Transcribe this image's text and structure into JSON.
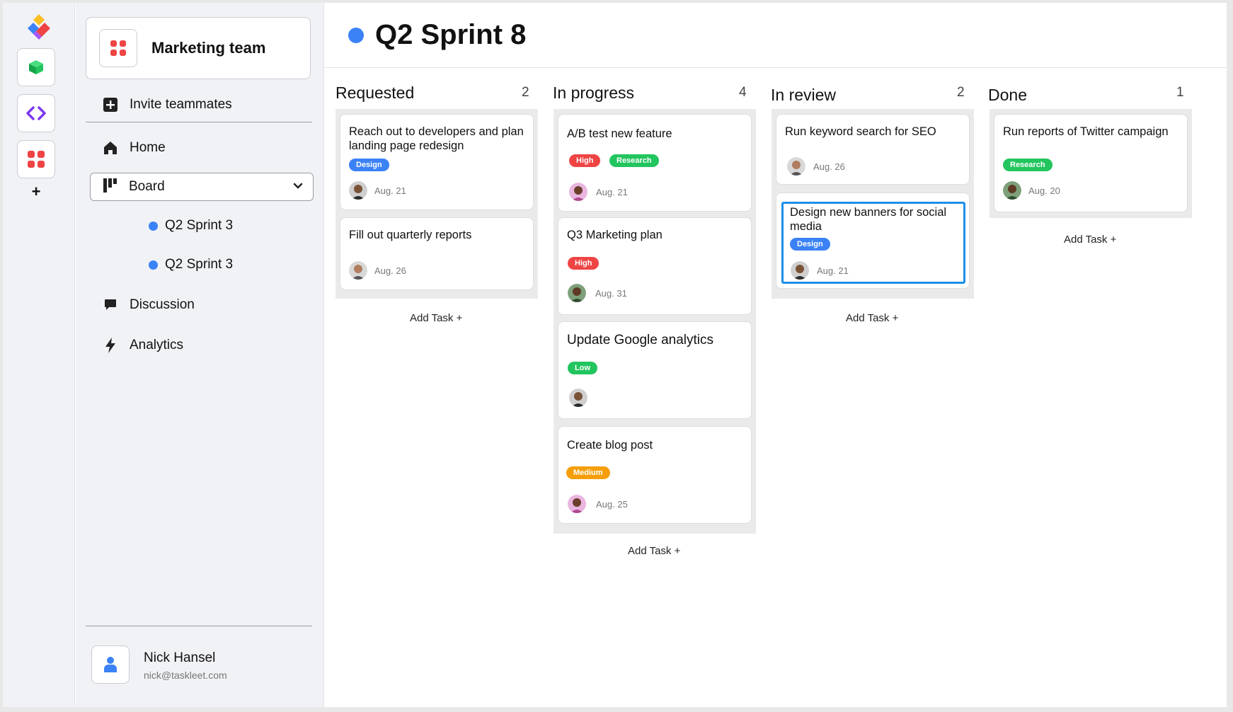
{
  "sidebar": {
    "team_name": "Marketing team",
    "invite_label": "Invite teammates",
    "nav": {
      "home": "Home",
      "board": "Board",
      "discussion": "Discussion",
      "analytics": "Analytics"
    },
    "sprints": [
      "Q2 Sprint 3",
      "Q2 Sprint 3"
    ],
    "user": {
      "name": "Nick Hansel",
      "email": "nick@taskleet.com"
    }
  },
  "header": {
    "title": "Q2 Sprint 8",
    "dot_color": "#3b82f6"
  },
  "add_task_label": "Add Task +",
  "columns": [
    {
      "title": "Requested",
      "count": "2",
      "cards": [
        {
          "title": "Reach out to developers and plan landing page redesign",
          "tags": [
            "Design"
          ],
          "date": "Aug. 21"
        },
        {
          "title": "Fill out quarterly reports",
          "tags": [],
          "date": "Aug. 26"
        }
      ]
    },
    {
      "title": "In progress",
      "count": "4",
      "cards": [
        {
          "title": "A/B test new feature",
          "tags": [
            "High",
            "Research"
          ],
          "date": "Aug. 21"
        },
        {
          "title": "Q3 Marketing plan",
          "tags": [
            "High"
          ],
          "date": "Aug. 31"
        },
        {
          "title": "Update Google analytics",
          "tags": [
            "Low"
          ],
          "date": ""
        },
        {
          "title": "Create blog post",
          "tags": [
            "Medium"
          ],
          "date": "Aug. 25"
        }
      ]
    },
    {
      "title": "In review",
      "count": "2",
      "cards": [
        {
          "title": "Run keyword search for SEO",
          "tags": [],
          "date": "Aug. 26"
        },
        {
          "title": "Design new banners for social media",
          "tags": [
            "Design"
          ],
          "date": "Aug. 21"
        }
      ]
    },
    {
      "title": "Done",
      "count": "1",
      "cards": [
        {
          "title": "Run reports of Twitter campaign",
          "tags": [
            "Research"
          ],
          "date": "Aug. 20"
        }
      ]
    }
  ],
  "colors": {
    "accent": "#3b82f6",
    "design": "#3b82f6",
    "high": "#ef4444",
    "research": "#22c55e",
    "low": "#22c55e",
    "medium": "#f59e0b",
    "selection": "#1d8fe8"
  }
}
